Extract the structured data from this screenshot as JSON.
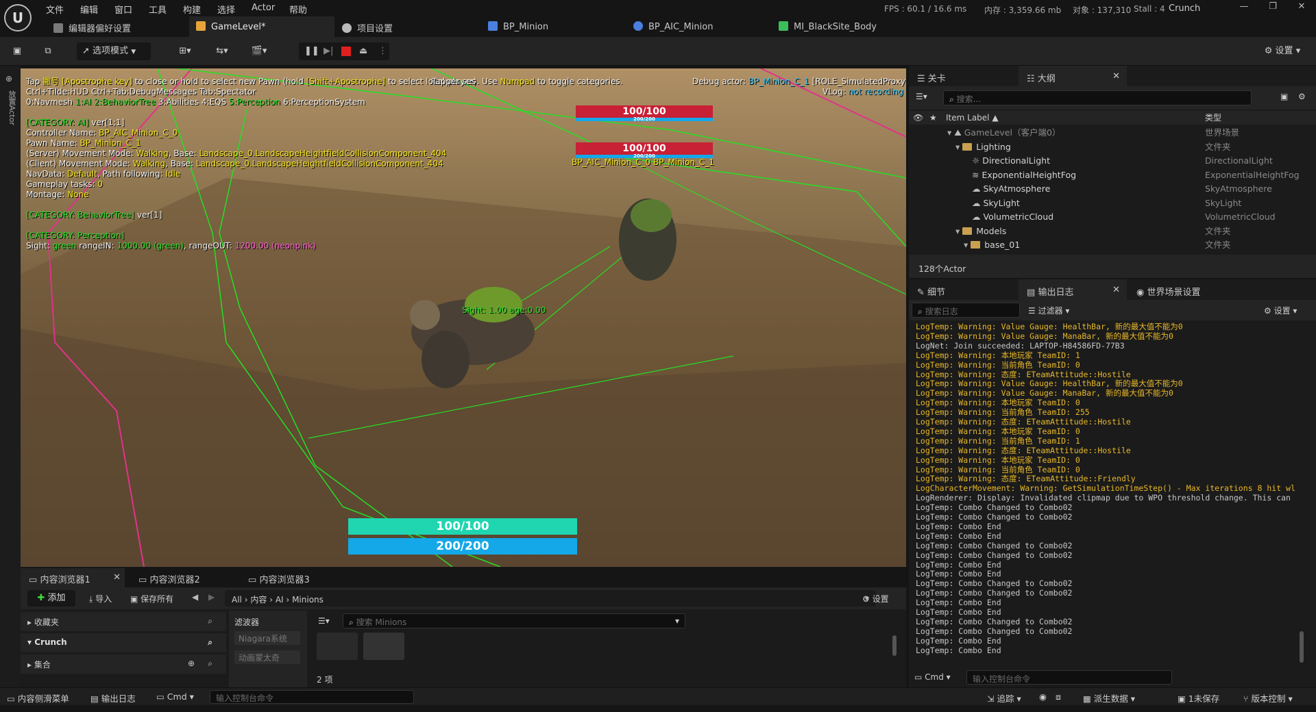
{
  "menubar": {
    "logo": "U",
    "items": [
      "文件",
      "编辑",
      "窗口",
      "工具",
      "构建",
      "选择",
      "Actor",
      "帮助"
    ],
    "stats": {
      "fps": "FPS : 60.1 / 16.6 ms",
      "mem": "内存 : 3,359.66 mb",
      "objects": "对象 : 137,310",
      "stall": "Stall : 4"
    },
    "project": "Crunch"
  },
  "tabs": [
    {
      "label": "编辑器偏好设置",
      "color": "#9a9a9a"
    },
    {
      "label": "GameLevel*",
      "color": "#e8a33a"
    },
    {
      "label": "项目设置",
      "color": "#bbbbbb"
    },
    {
      "label": "BP_Minion",
      "color": "#4a7fe0"
    },
    {
      "label": "BP_AIC_Minion",
      "color": "#4a7fe0"
    },
    {
      "label": "MI_BlackSite_Body",
      "color": "#3dbd5a"
    }
  ],
  "toolbar": {
    "mode": "选项模式",
    "settings": "设置"
  },
  "left_strip": "放置Actor",
  "viewport": {
    "hint1a": "Tap ",
    "hint1b": "撇号 [Apostrophe key]",
    "hint1c": " to close or hold to select new Pawn (hold ",
    "hint1d": "[Shift+Apostrophe]",
    "hint1e": " to select local player). Use ",
    "hint1f": "Numpad",
    "hint1g": " to toggle categories.",
    "hint_overlap": "Tapper ses",
    "hint2": "Ctrl+Tilde:HUD  Ctrl+Tab:DebugMessages  Tab:Spectator",
    "cats": [
      {
        "t": "0:Navmesh ",
        "c": "w"
      },
      {
        "t": "1:AI ",
        "c": "g"
      },
      {
        "t": "2:BehaviorTree ",
        "c": "g"
      },
      {
        "t": "3:Abilities ",
        "c": "w"
      },
      {
        "t": "4:EQS ",
        "c": "w"
      },
      {
        "t": "5:Perception ",
        "c": "g"
      },
      {
        "t": "6:PerceptionSystem",
        "c": "w"
      }
    ],
    "debug_actor_label": "Debug actor: ",
    "debug_actor": "BP_Minion_C_1",
    "debug_role": " [ROLE_SimulatedProxy]",
    "vlog_label": "VLog: ",
    "vlog": "not recording to file",
    "ai_lines": [
      [
        {
          "t": "[CATEGORY: AI]",
          "c": "g"
        },
        {
          "t": " ver[1;1]",
          "c": "w"
        }
      ],
      [
        {
          "t": "Controller Name: ",
          "c": "w"
        },
        {
          "t": "BP_AIC_Minion_C_0",
          "c": "y"
        }
      ],
      [
        {
          "t": "Pawn Name: ",
          "c": "w"
        },
        {
          "t": "BP_Minion_C_1",
          "c": "y"
        }
      ],
      [
        {
          "t": "(Server) Movement Mode: ",
          "c": "w"
        },
        {
          "t": "Walking",
          "c": "y"
        },
        {
          "t": ", Base: ",
          "c": "w"
        },
        {
          "t": "Landscape_0.LandscapeHeightfieldCollisionComponent_404",
          "c": "y"
        }
      ],
      [
        {
          "t": "(Client) Movement Mode: ",
          "c": "w"
        },
        {
          "t": "Walking",
          "c": "y"
        },
        {
          "t": ", Base: ",
          "c": "w"
        },
        {
          "t": "Landscape_0.LandscapeHeightfieldCollisionComponent_404",
          "c": "y"
        }
      ],
      [
        {
          "t": "NavData: ",
          "c": "w"
        },
        {
          "t": "Default",
          "c": "y"
        },
        {
          "t": ", Path following: ",
          "c": "w"
        },
        {
          "t": "Idle",
          "c": "y"
        }
      ],
      [
        {
          "t": "Gameplay tasks: ",
          "c": "w"
        },
        {
          "t": "0",
          "c": "y"
        }
      ],
      [
        {
          "t": "Montage: ",
          "c": "w"
        },
        {
          "t": "None",
          "c": "y"
        }
      ],
      [
        {
          "t": "",
          "c": "w"
        }
      ],
      [
        {
          "t": "[CATEGORY: BehaviorTree]",
          "c": "g"
        },
        {
          "t": " ver[1]",
          "c": "w"
        }
      ],
      [
        {
          "t": "",
          "c": "w"
        }
      ],
      [
        {
          "t": "[CATEGORY: Perception]",
          "c": "g"
        }
      ],
      [
        {
          "t": "Sight: ",
          "c": "w"
        },
        {
          "t": "green",
          "c": "g"
        },
        {
          "t": " rangeIN: ",
          "c": "w"
        },
        {
          "t": "1000.00 (green)",
          "c": "g"
        },
        {
          "t": ", rangeOUT: ",
          "c": "w"
        },
        {
          "t": "1200.00 (neonpink)",
          "c": "p"
        }
      ]
    ],
    "enemy_hp1": "100/100",
    "enemy_hp1_fill": 1.0,
    "enemy_mp1": "200/200",
    "enemy_hp2": "100/100",
    "enemy_hp2_fill": 1.0,
    "enemy_mp2": "200/200",
    "enemy_tag": "BP_AIC_Minion_C_0 BP_Minion_C_1",
    "sight_tag": "Sight: 1.00 age:0.00",
    "player_hp": "100/100",
    "player_hp_fill": 1.0,
    "player_mp": "200/200",
    "player_mp_fill": 1.0,
    "colors": {
      "hp": "#1fd6b0",
      "mp": "#14a8e8",
      "enemy_hp": "#d8233a"
    }
  },
  "outliner": {
    "tab_level": "关卡",
    "tab_outliner": "大纲",
    "search_placeholder": "搜索...",
    "col_label": "Item Label ▲",
    "col_type": "类型",
    "rows": [
      {
        "label": "GameLevel（客户端0）",
        "type": "世界场景",
        "indent": 56,
        "kind": "level"
      },
      {
        "label": "Lighting",
        "type": "文件夹",
        "indent": 68,
        "kind": "folder"
      },
      {
        "label": "DirectionalLight",
        "type": "DirectionalLight",
        "indent": 92,
        "kind": "light"
      },
      {
        "label": "ExponentialHeightFog",
        "type": "ExponentialHeightFog",
        "indent": 92,
        "kind": "fog"
      },
      {
        "label": "SkyAtmosphere",
        "type": "SkyAtmosphere",
        "indent": 92,
        "kind": "sky"
      },
      {
        "label": "SkyLight",
        "type": "SkyLight",
        "indent": 92,
        "kind": "sky"
      },
      {
        "label": "VolumetricCloud",
        "type": "VolumetricCloud",
        "indent": 92,
        "kind": "cloud"
      },
      {
        "label": "Models",
        "type": "文件夹",
        "indent": 68,
        "kind": "folder"
      },
      {
        "label": "base_01",
        "type": "文件夹",
        "indent": 80,
        "kind": "folder"
      }
    ],
    "footer": "128个Actor"
  },
  "details": {
    "tab_details": "细节",
    "tab_log": "输出日志",
    "tab_world": "世界场景设置",
    "search_placeholder": "搜索日志",
    "filter": "过滤器",
    "settings": "设置",
    "cmd": "Cmd",
    "cmd_placeholder": "输入控制台命令",
    "log": [
      {
        "t": "LogTemp: Warning: Value Gauge: HealthBar, 新的最大值不能为0",
        "w": true
      },
      {
        "t": "LogTemp: Warning: Value Gauge: ManaBar, 新的最大值不能为0",
        "w": true
      },
      {
        "t": "LogNet: Join succeeded: LAPTOP-H84586FD-77B3",
        "w": false
      },
      {
        "t": "LogTemp: Warning: 本地玩家 TeamID: 1",
        "w": true
      },
      {
        "t": "LogTemp: Warning: 当前角色 TeamID: 0",
        "w": true
      },
      {
        "t": "LogTemp: Warning: 态度: ETeamAttitude::Hostile",
        "w": true
      },
      {
        "t": "LogTemp: Warning: Value Gauge: HealthBar, 新的最大值不能为0",
        "w": true
      },
      {
        "t": "LogTemp: Warning: Value Gauge: ManaBar, 新的最大值不能为0",
        "w": true
      },
      {
        "t": "LogTemp: Warning: 本地玩家 TeamID: 0",
        "w": true
      },
      {
        "t": "LogTemp: Warning: 当前角色 TeamID: 255",
        "w": true
      },
      {
        "t": "LogTemp: Warning: 态度: ETeamAttitude::Hostile",
        "w": true
      },
      {
        "t": "LogTemp: Warning: 本地玩家 TeamID: 0",
        "w": true
      },
      {
        "t": "LogTemp: Warning: 当前角色 TeamID: 1",
        "w": true
      },
      {
        "t": "LogTemp: Warning: 态度: ETeamAttitude::Hostile",
        "w": true
      },
      {
        "t": "LogTemp: Warning: 本地玩家 TeamID: 0",
        "w": true
      },
      {
        "t": "LogTemp: Warning: 当前角色 TeamID: 0",
        "w": true
      },
      {
        "t": "LogTemp: Warning: 态度: ETeamAttitude::Friendly",
        "w": true
      },
      {
        "t": "LogCharacterMovement: Warning: GetSimulationTimeStep() - Max iterations 8 hit wl",
        "w": true
      },
      {
        "t": "LogRenderer: Display: Invalidated clipmap due to WPO threshold change. This can",
        "w": false
      },
      {
        "t": "LogTemp: Combo Changed to Combo02",
        "w": false
      },
      {
        "t": "LogTemp: Combo Changed to Combo02",
        "w": false
      },
      {
        "t": "LogTemp: Combo End",
        "w": false
      },
      {
        "t": "LogTemp: Combo End",
        "w": false
      },
      {
        "t": "LogTemp: Combo Changed to Combo02",
        "w": false
      },
      {
        "t": "LogTemp: Combo Changed to Combo02",
        "w": false
      },
      {
        "t": "LogTemp: Combo End",
        "w": false
      },
      {
        "t": "LogTemp: Combo End",
        "w": false
      },
      {
        "t": "LogTemp: Combo Changed to Combo02",
        "w": false
      },
      {
        "t": "LogTemp: Combo Changed to Combo02",
        "w": false
      },
      {
        "t": "LogTemp: Combo End",
        "w": false
      },
      {
        "t": "LogTemp: Combo End",
        "w": false
      },
      {
        "t": "LogTemp: Combo Changed to Combo02",
        "w": false
      },
      {
        "t": "LogTemp: Combo Changed to Combo02",
        "w": false
      },
      {
        "t": "LogTemp: Combo End",
        "w": false
      },
      {
        "t": "LogTemp: Combo End",
        "w": false
      }
    ]
  },
  "content_browser": {
    "tabs": [
      "内容浏览器1",
      "内容浏览器2",
      "内容浏览器3"
    ],
    "add": "添加",
    "import": "导入",
    "save_all": "保存所有",
    "path": [
      "All",
      "内容",
      "AI",
      "Minions"
    ],
    "settings": "设置",
    "sources": [
      {
        "label": "收藏夹",
        "open": false
      },
      {
        "label": "Crunch",
        "open": true
      },
      {
        "label": "集合",
        "open": false
      }
    ],
    "filters_title": "滤波器",
    "filters": [
      "Niagara系统",
      "动画蒙太奇"
    ],
    "search_placeholder": "搜索 Minions",
    "count": "2 项"
  },
  "statusbar": {
    "drawer": "内容侧滑菜单",
    "output": "输出日志",
    "cmd": "Cmd",
    "cmd_placeholder": "输入控制台命令",
    "trace": "追踪",
    "derived": "派生数据",
    "unsaved": "1未保存",
    "source_control": "版本控制"
  }
}
